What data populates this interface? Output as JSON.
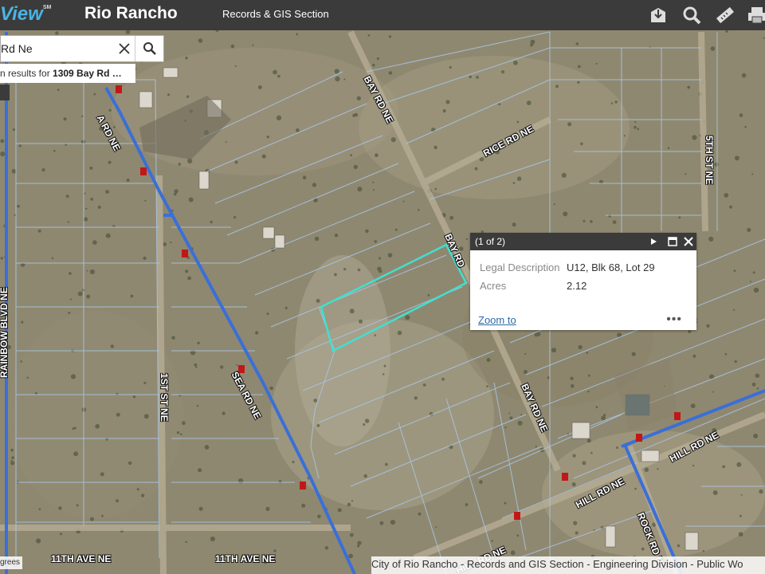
{
  "header": {
    "logo_text": "View",
    "logo_sup": "SM",
    "city": "Rio Rancho",
    "section": "Records & GIS Section",
    "tools": [
      "bookmark-icon",
      "search-icon",
      "measure-icon",
      "print-icon"
    ]
  },
  "search": {
    "value": "Rd Ne",
    "hint_prefix": "n results for ",
    "hint_query": "1309 Bay Rd …"
  },
  "popup": {
    "title": "(1 of 2)",
    "fields": [
      {
        "label": "Legal Description",
        "value": "U12, Blk 68, Lot 29"
      },
      {
        "label": "Acres",
        "value": "2.12"
      }
    ],
    "zoom_label": "Zoom to",
    "more_label": "•••"
  },
  "street_labels": {
    "bay_rd_top": "BAY RD NE",
    "bay_rd_mid": "BAY RD",
    "bay_rd_low": "BAY RD NE",
    "rice_rd": "RICE RD NE",
    "fifth_st": "5TH ST NE",
    "rainbow": "RAINBOW BLVD NE",
    "first_st": "1ST ST NE",
    "sea_rd": "SEA RD NE",
    "sea_rd_top": "A RD NE",
    "hill_rd_1": "HILL RD NE",
    "hill_rd_2": "HILL RD NE",
    "hill_rd_3": "HILL RD NE",
    "rock_rd": "ROCK RD NE",
    "eleventh_1": "11TH AVE NE",
    "eleventh_2": "11TH AVE NE"
  },
  "attribution": "City of Rio Rancho - Records and GIS Section - Engineering Division - Public Wo",
  "scale_text": "grees",
  "colors": {
    "header_bg": "#3b3b3b",
    "parcel_line": "#a8c8e8",
    "selected_parcel": "#40e0d0",
    "road_blue": "#3a6fd8"
  }
}
